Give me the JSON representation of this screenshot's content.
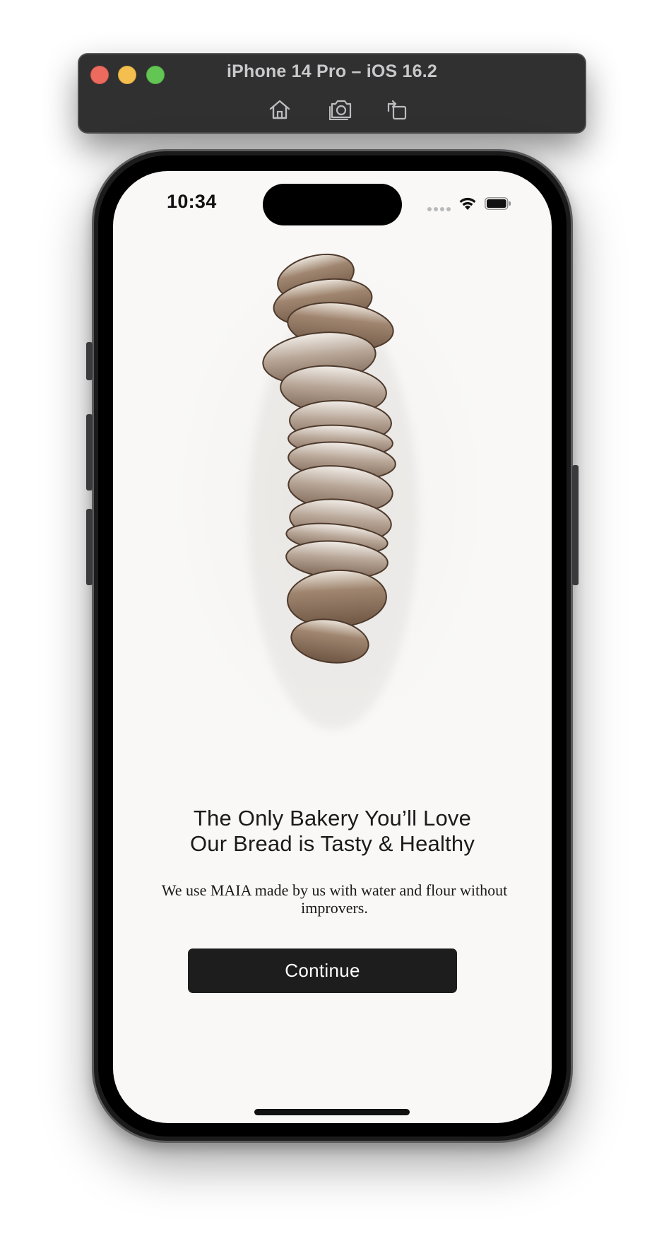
{
  "simulator": {
    "title": "iPhone 14 Pro – iOS 16.2",
    "toolbar": [
      {
        "icon": "home-icon"
      },
      {
        "icon": "camera-screenshot-icon"
      },
      {
        "icon": "rotate-icon"
      }
    ],
    "colors": {
      "titlebar": "#303031",
      "close": "#ed6a5e",
      "minimize": "#f5bf4f",
      "zoom": "#62c554"
    }
  },
  "status_bar": {
    "time": "10:34",
    "icons": [
      "cellular-signal-icon",
      "wifi-icon",
      "battery-icon"
    ]
  },
  "onboarding": {
    "hero_image": "sliced-bread-loaf-image",
    "headline_line1": "The Only Bakery You’ll Love",
    "headline_line2": "Our Bread is Tasty & Healthy",
    "description": "We use MAIA made by us with water and flour without improvers.",
    "continue_label": "Continue",
    "colors": {
      "background": "#f9f8f7",
      "button": "#1d1d1d",
      "button_text": "#ffffff",
      "text": "#1a1a1a"
    }
  }
}
